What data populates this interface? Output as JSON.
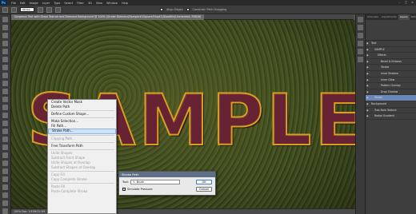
{
  "menubar": {
    "logo": "Ps",
    "items": [
      "File",
      "Edit",
      "Image",
      "Layer",
      "Type",
      "Select",
      "Filter",
      "3D",
      "View",
      "Window",
      "Help"
    ],
    "window_buttons": [
      "–",
      "□",
      "×"
    ]
  },
  "options": {
    "path_ops_label": "Stroke",
    "align_edges_label": "Align Edges",
    "constrain_label": "Constrain Path Dragging"
  },
  "document": {
    "tab_title": "Gorgeous Text with Grass Texture and Diamond Background @ 100% (Stroke Diamond/Sample#1Square/Shp#1(SlowWin)Unchecked, RGB/8)",
    "canvas_text": "SAMPLE",
    "status": "100%   Doc: 1.83M/15.5M"
  },
  "context_menu": {
    "items": [
      {
        "label": "Create Vector Mask",
        "disabled": false
      },
      {
        "label": "Delete Path",
        "disabled": false
      },
      {
        "sep": true
      },
      {
        "label": "Define Custom Shape...",
        "disabled": false
      },
      {
        "sep": true
      },
      {
        "label": "Make Selection...",
        "disabled": false
      },
      {
        "label": "Fill Path...",
        "disabled": false
      },
      {
        "label": "Stroke Path...",
        "disabled": false,
        "highlight": true
      },
      {
        "sep": true
      },
      {
        "label": "Clipping Path...",
        "disabled": true
      },
      {
        "sep": true
      },
      {
        "label": "Free Transform Path",
        "disabled": false
      },
      {
        "sep": true
      },
      {
        "label": "Unite Shapes",
        "disabled": true
      },
      {
        "label": "Subtract Front Shape",
        "disabled": true
      },
      {
        "label": "Unite Shapes at Overlap",
        "disabled": true
      },
      {
        "label": "Subtract Shapes at Overlap",
        "disabled": true
      },
      {
        "sep": true
      },
      {
        "label": "Copy Fill",
        "disabled": true
      },
      {
        "label": "Copy Complete Stroke",
        "disabled": true
      },
      {
        "sep": true
      },
      {
        "label": "Paste Fill",
        "disabled": true
      },
      {
        "label": "Paste Complete Stroke",
        "disabled": true
      }
    ]
  },
  "dialog": {
    "title": "Stroke Path",
    "tool_label": "Tool:",
    "tool_value": "Brush",
    "simulate_label": "Simulate Pressure",
    "ok_label": "OK",
    "cancel_label": "Cancel"
  },
  "layers_panel": {
    "tabs": [
      "Channels",
      "Adjustments",
      "Layers",
      "Paths"
    ],
    "active_tab": "Layers",
    "rows": [
      {
        "label": "Text",
        "indent": 0,
        "selected": false
      },
      {
        "label": "SAMPLE",
        "indent": 1,
        "selected": false
      },
      {
        "label": "Effects",
        "indent": 2,
        "selected": false
      },
      {
        "label": "Bevel & Emboss",
        "indent": 3,
        "selected": false
      },
      {
        "label": "Stroke",
        "indent": 3,
        "selected": false
      },
      {
        "label": "Inner Shadow",
        "indent": 3,
        "selected": false
      },
      {
        "label": "Inner Glow",
        "indent": 3,
        "selected": false
      },
      {
        "label": "Pattern Overlay",
        "indent": 3,
        "selected": false
      },
      {
        "label": "Drop Shadow",
        "indent": 3,
        "selected": false
      },
      {
        "label": "Stroke",
        "indent": 1,
        "selected": true
      },
      {
        "label": "Background",
        "indent": 0,
        "selected": false
      },
      {
        "label": "Tree Bark Texture",
        "indent": 1,
        "selected": false
      },
      {
        "label": "Radial Gradient",
        "indent": 1,
        "selected": false
      }
    ]
  },
  "colors": {
    "accent_selection": "#6b87b8",
    "text_stroke": "#d9a020",
    "text_fill": "#822846"
  }
}
